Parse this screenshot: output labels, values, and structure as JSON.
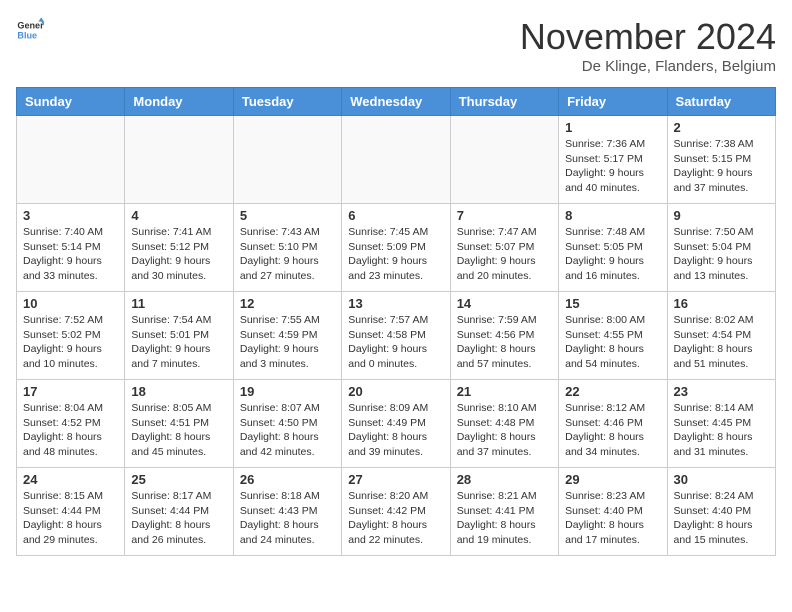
{
  "header": {
    "logo_general": "General",
    "logo_blue": "Blue",
    "month_title": "November 2024",
    "location": "De Klinge, Flanders, Belgium"
  },
  "weekdays": [
    "Sunday",
    "Monday",
    "Tuesday",
    "Wednesday",
    "Thursday",
    "Friday",
    "Saturday"
  ],
  "weeks": [
    [
      {
        "day": "",
        "info": ""
      },
      {
        "day": "",
        "info": ""
      },
      {
        "day": "",
        "info": ""
      },
      {
        "day": "",
        "info": ""
      },
      {
        "day": "",
        "info": ""
      },
      {
        "day": "1",
        "info": "Sunrise: 7:36 AM\nSunset: 5:17 PM\nDaylight: 9 hours and 40 minutes."
      },
      {
        "day": "2",
        "info": "Sunrise: 7:38 AM\nSunset: 5:15 PM\nDaylight: 9 hours and 37 minutes."
      }
    ],
    [
      {
        "day": "3",
        "info": "Sunrise: 7:40 AM\nSunset: 5:14 PM\nDaylight: 9 hours and 33 minutes."
      },
      {
        "day": "4",
        "info": "Sunrise: 7:41 AM\nSunset: 5:12 PM\nDaylight: 9 hours and 30 minutes."
      },
      {
        "day": "5",
        "info": "Sunrise: 7:43 AM\nSunset: 5:10 PM\nDaylight: 9 hours and 27 minutes."
      },
      {
        "day": "6",
        "info": "Sunrise: 7:45 AM\nSunset: 5:09 PM\nDaylight: 9 hours and 23 minutes."
      },
      {
        "day": "7",
        "info": "Sunrise: 7:47 AM\nSunset: 5:07 PM\nDaylight: 9 hours and 20 minutes."
      },
      {
        "day": "8",
        "info": "Sunrise: 7:48 AM\nSunset: 5:05 PM\nDaylight: 9 hours and 16 minutes."
      },
      {
        "day": "9",
        "info": "Sunrise: 7:50 AM\nSunset: 5:04 PM\nDaylight: 9 hours and 13 minutes."
      }
    ],
    [
      {
        "day": "10",
        "info": "Sunrise: 7:52 AM\nSunset: 5:02 PM\nDaylight: 9 hours and 10 minutes."
      },
      {
        "day": "11",
        "info": "Sunrise: 7:54 AM\nSunset: 5:01 PM\nDaylight: 9 hours and 7 minutes."
      },
      {
        "day": "12",
        "info": "Sunrise: 7:55 AM\nSunset: 4:59 PM\nDaylight: 9 hours and 3 minutes."
      },
      {
        "day": "13",
        "info": "Sunrise: 7:57 AM\nSunset: 4:58 PM\nDaylight: 9 hours and 0 minutes."
      },
      {
        "day": "14",
        "info": "Sunrise: 7:59 AM\nSunset: 4:56 PM\nDaylight: 8 hours and 57 minutes."
      },
      {
        "day": "15",
        "info": "Sunrise: 8:00 AM\nSunset: 4:55 PM\nDaylight: 8 hours and 54 minutes."
      },
      {
        "day": "16",
        "info": "Sunrise: 8:02 AM\nSunset: 4:54 PM\nDaylight: 8 hours and 51 minutes."
      }
    ],
    [
      {
        "day": "17",
        "info": "Sunrise: 8:04 AM\nSunset: 4:52 PM\nDaylight: 8 hours and 48 minutes."
      },
      {
        "day": "18",
        "info": "Sunrise: 8:05 AM\nSunset: 4:51 PM\nDaylight: 8 hours and 45 minutes."
      },
      {
        "day": "19",
        "info": "Sunrise: 8:07 AM\nSunset: 4:50 PM\nDaylight: 8 hours and 42 minutes."
      },
      {
        "day": "20",
        "info": "Sunrise: 8:09 AM\nSunset: 4:49 PM\nDaylight: 8 hours and 39 minutes."
      },
      {
        "day": "21",
        "info": "Sunrise: 8:10 AM\nSunset: 4:48 PM\nDaylight: 8 hours and 37 minutes."
      },
      {
        "day": "22",
        "info": "Sunrise: 8:12 AM\nSunset: 4:46 PM\nDaylight: 8 hours and 34 minutes."
      },
      {
        "day": "23",
        "info": "Sunrise: 8:14 AM\nSunset: 4:45 PM\nDaylight: 8 hours and 31 minutes."
      }
    ],
    [
      {
        "day": "24",
        "info": "Sunrise: 8:15 AM\nSunset: 4:44 PM\nDaylight: 8 hours and 29 minutes."
      },
      {
        "day": "25",
        "info": "Sunrise: 8:17 AM\nSunset: 4:44 PM\nDaylight: 8 hours and 26 minutes."
      },
      {
        "day": "26",
        "info": "Sunrise: 8:18 AM\nSunset: 4:43 PM\nDaylight: 8 hours and 24 minutes."
      },
      {
        "day": "27",
        "info": "Sunrise: 8:20 AM\nSunset: 4:42 PM\nDaylight: 8 hours and 22 minutes."
      },
      {
        "day": "28",
        "info": "Sunrise: 8:21 AM\nSunset: 4:41 PM\nDaylight: 8 hours and 19 minutes."
      },
      {
        "day": "29",
        "info": "Sunrise: 8:23 AM\nSunset: 4:40 PM\nDaylight: 8 hours and 17 minutes."
      },
      {
        "day": "30",
        "info": "Sunrise: 8:24 AM\nSunset: 4:40 PM\nDaylight: 8 hours and 15 minutes."
      }
    ]
  ]
}
